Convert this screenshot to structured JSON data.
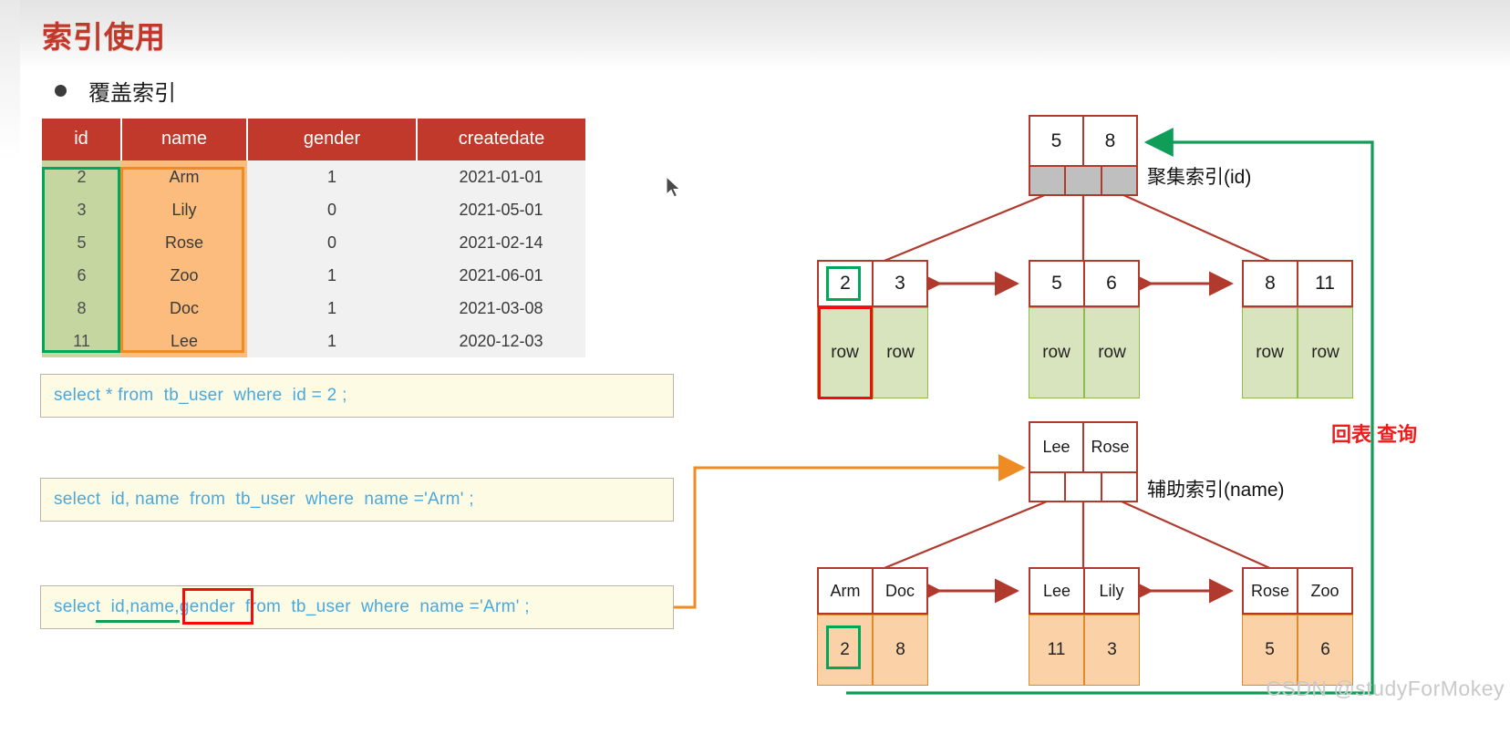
{
  "page": {
    "title": "索引使用",
    "bullet": "覆盖索引",
    "watermark": "CSDN @studyForMokey",
    "accent_red": "#c0392b",
    "accent_green": "#00a65a",
    "accent_orange": "#ef8b23",
    "sql_text_color": "#4aa8dd"
  },
  "table": {
    "columns": [
      "id",
      "name",
      "gender",
      "createdate"
    ],
    "rows": [
      {
        "id": "2",
        "name": "Arm",
        "gender": "1",
        "createdate": "2021-01-01"
      },
      {
        "id": "3",
        "name": "Lily",
        "gender": "0",
        "createdate": "2021-05-01"
      },
      {
        "id": "5",
        "name": "Rose",
        "gender": "0",
        "createdate": "2021-02-14"
      },
      {
        "id": "6",
        "name": "Zoo",
        "gender": "1",
        "createdate": "2021-06-01"
      },
      {
        "id": "8",
        "name": "Doc",
        "gender": "1",
        "createdate": "2021-03-08"
      },
      {
        "id": "11",
        "name": "Lee",
        "gender": "1",
        "createdate": "2020-12-03"
      }
    ]
  },
  "sql": {
    "q1": "select * from  tb_user  where  id = 2 ;",
    "q2": "select  id, name  from  tb_user  where  name ='Arm' ;",
    "q3": "select  id,name,gender  from  tb_user  where  name ='Arm' ;"
  },
  "clustered_index": {
    "label": "聚集索引(id)",
    "root_keys": [
      "5",
      "8"
    ],
    "leaves": [
      {
        "keys": [
          "2",
          "3"
        ],
        "rows": [
          "row",
          "row"
        ]
      },
      {
        "keys": [
          "5",
          "6"
        ],
        "rows": [
          "row",
          "row"
        ]
      },
      {
        "keys": [
          "8",
          "11"
        ],
        "rows": [
          "row",
          "row"
        ]
      }
    ]
  },
  "secondary_index": {
    "label": "辅助索引(name)",
    "root_keys": [
      "Lee",
      "Rose"
    ],
    "leaves": [
      {
        "keys": [
          "Arm",
          "Doc"
        ],
        "ids": [
          "2",
          "8"
        ]
      },
      {
        "keys": [
          "Lee",
          "Lily"
        ],
        "ids": [
          "11",
          "3"
        ]
      },
      {
        "keys": [
          "Rose",
          "Zoo"
        ],
        "ids": [
          "5",
          "6"
        ]
      }
    ]
  },
  "annotations": {
    "lookup": "回表 查询"
  }
}
